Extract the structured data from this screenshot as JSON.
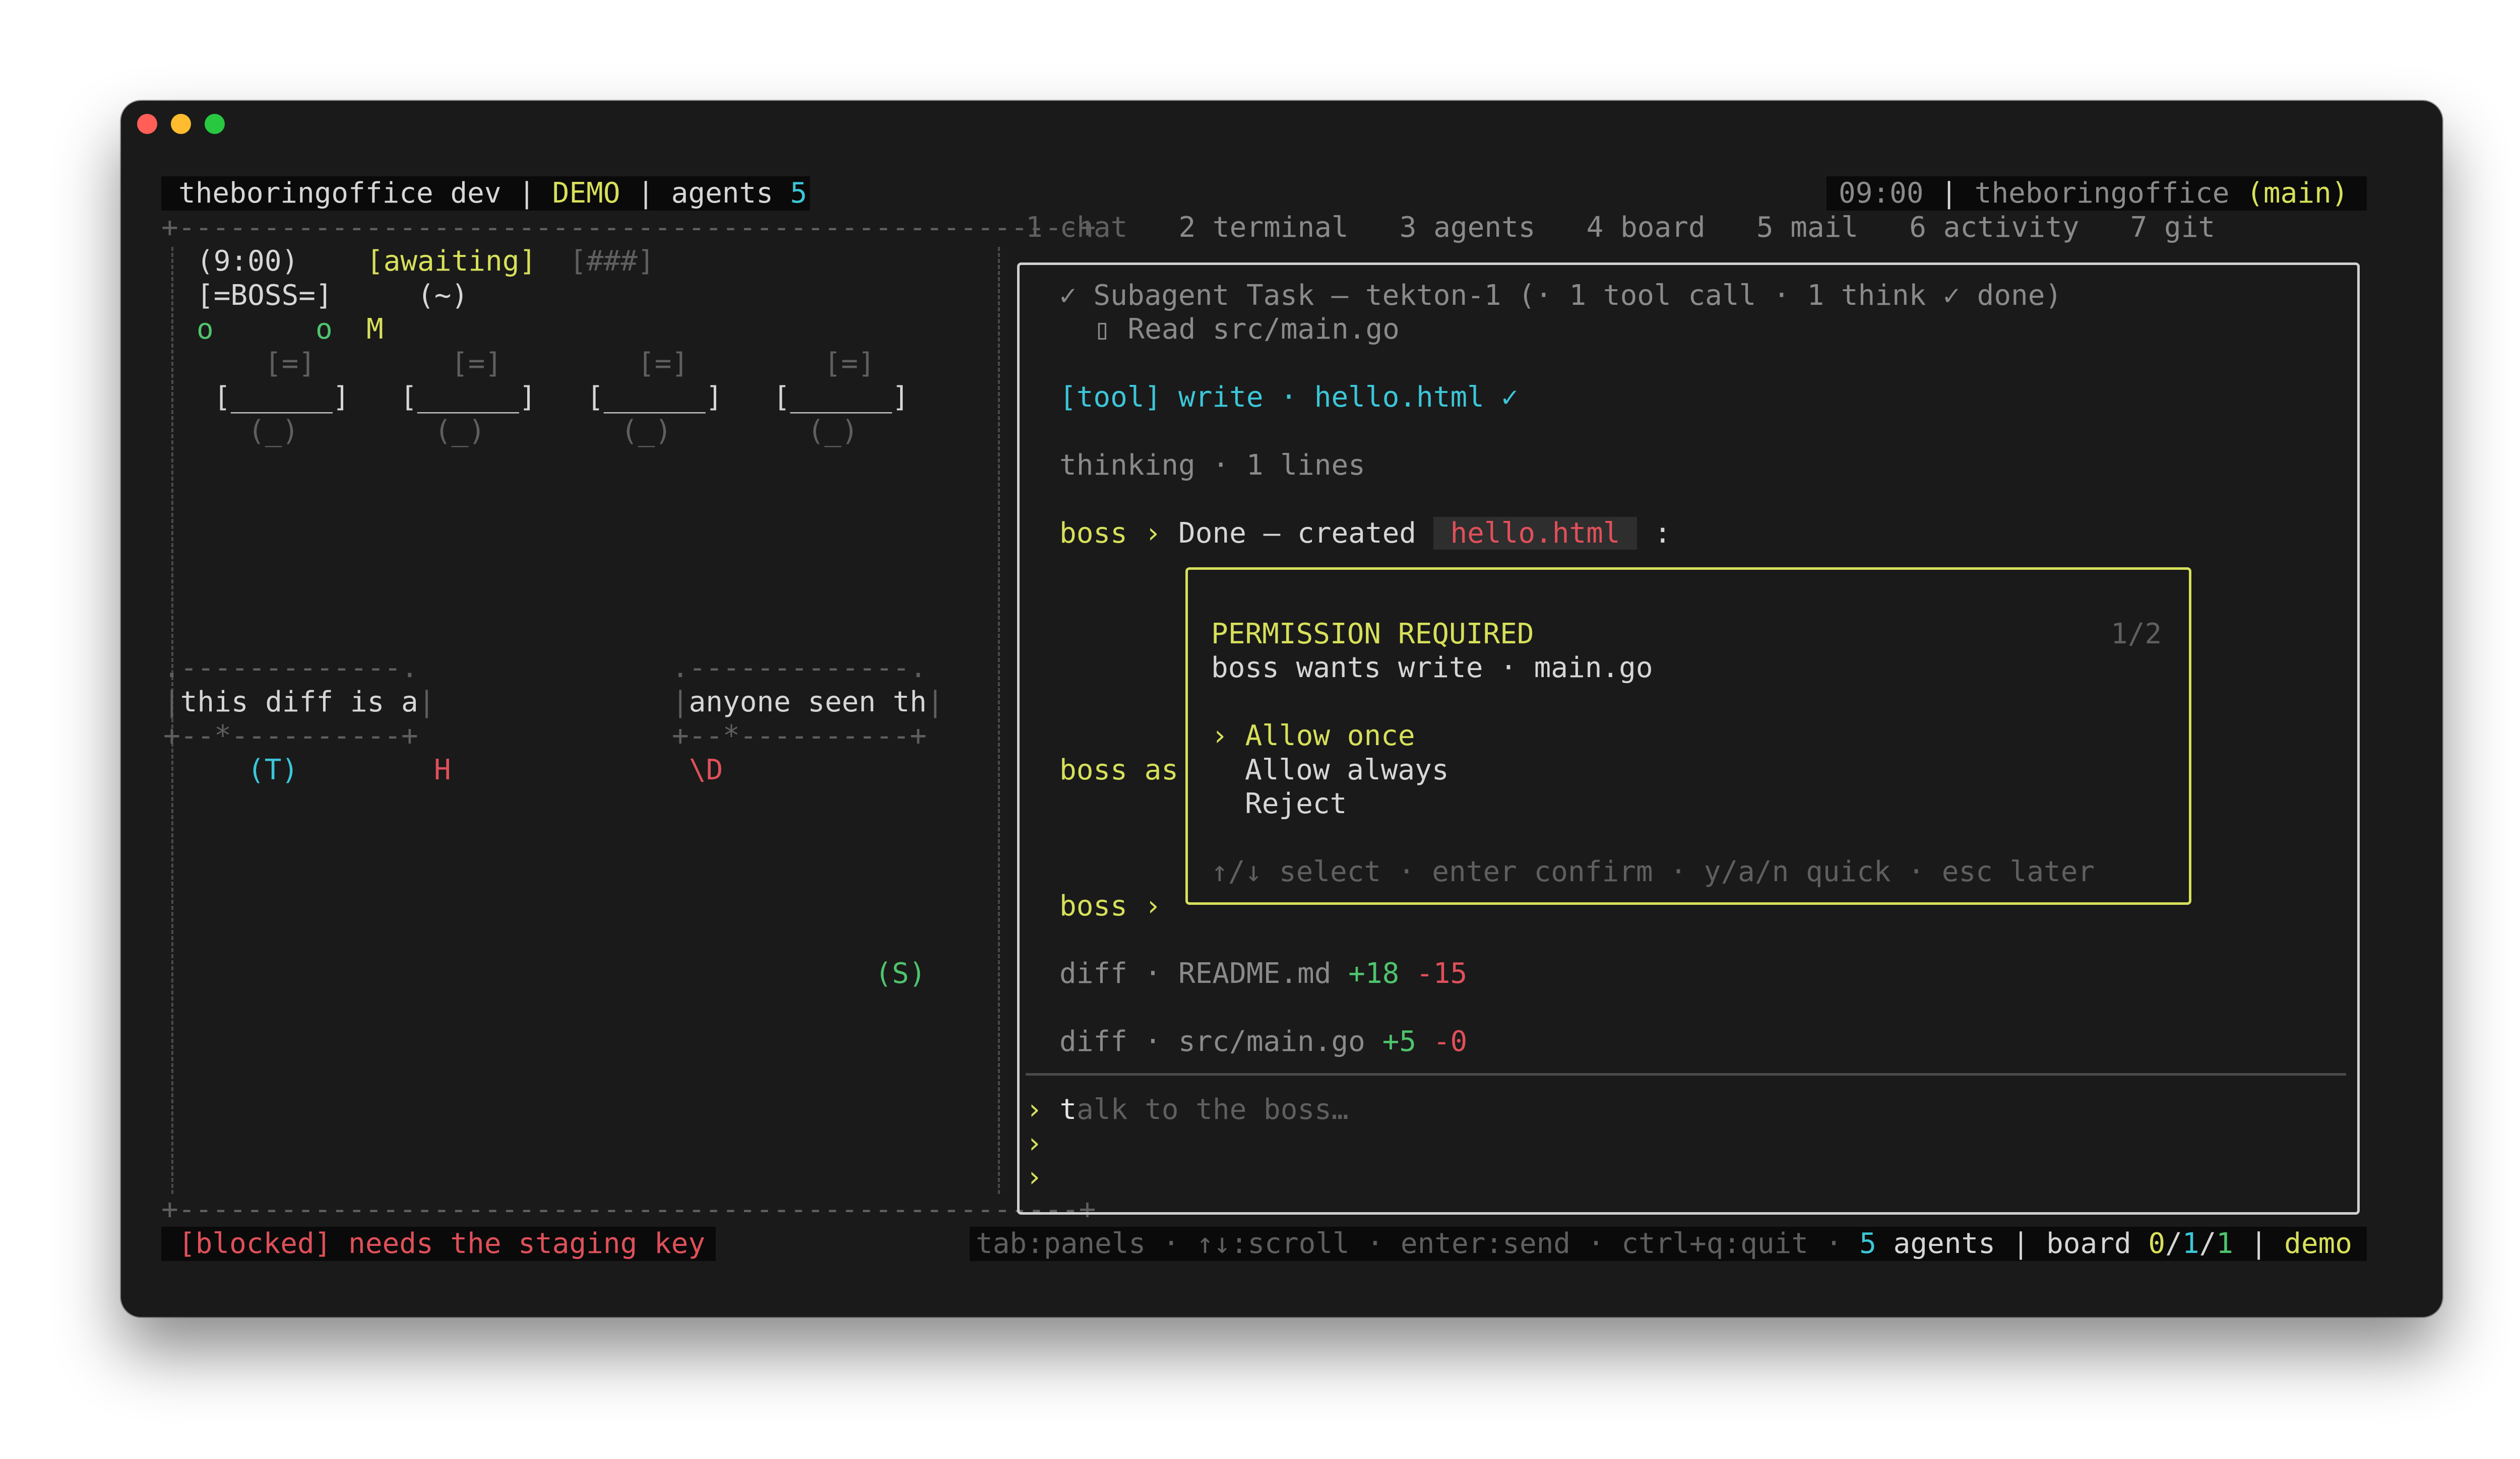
{
  "window": {
    "buttons": [
      "close",
      "minimize",
      "maximize"
    ]
  },
  "colors": {
    "yellow": "#d7e05a",
    "cyan": "#3cc6d8",
    "green": "#4fc46d",
    "red": "#e0505a",
    "dim": "#5f5f5f"
  },
  "header": {
    "app": "theboringoffice dev",
    "sep": "|",
    "mode": "DEMO",
    "agents_label": "agents",
    "agents_count": "5",
    "clock": "09:00",
    "repo": "theboringoffice",
    "branch": "(main)"
  },
  "tabs": [
    {
      "num": "1",
      "label": "chat"
    },
    {
      "num": "2",
      "label": "terminal"
    },
    {
      "num": "3",
      "label": "agents"
    },
    {
      "num": "4",
      "label": "board"
    },
    {
      "num": "5",
      "label": "mail"
    },
    {
      "num": "6",
      "label": "activity"
    },
    {
      "num": "7",
      "label": "git"
    }
  ],
  "office": {
    "clock": "(9:00)",
    "awaiting": "[awaiting]",
    "hashes": "[###]",
    "boss": "[=BOSS=]",
    "tilde": "(~)",
    "people": [
      "o",
      "o",
      "M"
    ],
    "monitor": "[=]",
    "desk": "[______]",
    "chair": "(_)",
    "bubble_border_top": ".-------------.",
    "bubble_border_bottom": "+--*----------+",
    "bubble1": "this diff is a",
    "bubble2": "anyone seen th",
    "agent_t": "(T)",
    "agent_h": "H",
    "agent_d": "\\D",
    "agent_s": "(S)"
  },
  "chat": {
    "subagent_line": "✓ Subagent Task — tekton-1 (· 1 tool call · 1 think ✓ done)",
    "subagent_read": "▯ Read src/main.go",
    "tool_line": "[tool] write · hello.html ✓",
    "thinking": "thinking · 1 lines",
    "boss_prefix": "boss ›",
    "boss_done": "Done — created",
    "boss_done_file": " hello.html ",
    "boss_done_colon": ":",
    "boss_as": "boss as",
    "boss_empty": "boss ›",
    "diffs": [
      {
        "label": "diff · README.md",
        "plus": "+18",
        "minus": "-15"
      },
      {
        "label": "diff · src/main.go",
        "plus": "+5",
        "minus": "-0"
      }
    ],
    "input_placeholder_first": "t",
    "input_placeholder_rest": "alk to the boss…",
    "prompt": "›"
  },
  "permission": {
    "title": "PERMISSION REQUIRED",
    "counter": "1/2",
    "request": "boss wants write · main.go",
    "options": [
      {
        "label": "Allow once",
        "selected": true
      },
      {
        "label": "Allow always",
        "selected": false
      },
      {
        "label": "Reject",
        "selected": false
      }
    ],
    "selector": "›",
    "hint": "↑/↓ select · enter confirm · y/a/n quick · esc later"
  },
  "status": {
    "blocked": "[blocked] needs the staging key",
    "hints": "tab:panels · ↑↓:scroll · enter:send · ctrl+q:quit ·",
    "agents_count": "5",
    "agents_label": "agents",
    "board_label": "board",
    "board_a": "0",
    "board_b": "1",
    "board_c": "1",
    "slash": "/",
    "mode": "demo"
  }
}
